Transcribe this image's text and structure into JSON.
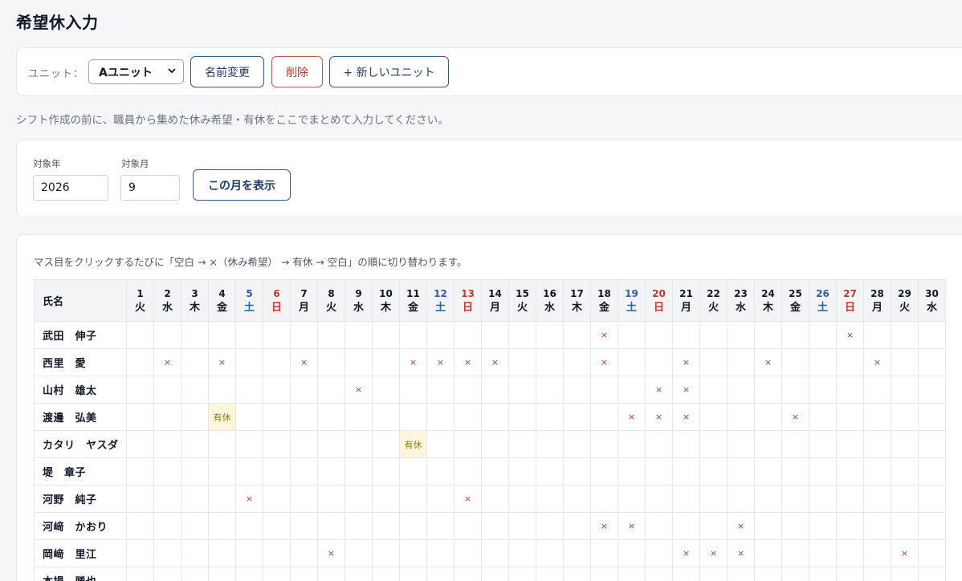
{
  "title": "希望休入力",
  "unit": {
    "label": "ユニット：",
    "selected": "Aユニット",
    "rename_label": "名前変更",
    "delete_label": "削除",
    "new_label": "+ 新しいユニット"
  },
  "note": "シフト作成の前に、職員から集めた休み希望・有休をここでまとめて入力してください。",
  "period": {
    "year_label": "対象年",
    "year_value": "2026",
    "month_label": "対象月",
    "month_value": "9",
    "show_label": "この月を表示"
  },
  "grid": {
    "hint": "マス目をクリックするたびに「空白 → ×（休み希望） → 有休 → 空白」の順に切り替わります。",
    "name_header": "氏名",
    "days": [
      {
        "d": "1",
        "w": "火",
        "t": "weekday"
      },
      {
        "d": "2",
        "w": "水",
        "t": "weekday"
      },
      {
        "d": "3",
        "w": "木",
        "t": "weekday"
      },
      {
        "d": "4",
        "w": "金",
        "t": "weekday"
      },
      {
        "d": "5",
        "w": "土",
        "t": "sat"
      },
      {
        "d": "6",
        "w": "日",
        "t": "sun"
      },
      {
        "d": "7",
        "w": "月",
        "t": "weekday"
      },
      {
        "d": "8",
        "w": "火",
        "t": "weekday"
      },
      {
        "d": "9",
        "w": "水",
        "t": "weekday"
      },
      {
        "d": "10",
        "w": "木",
        "t": "weekday"
      },
      {
        "d": "11",
        "w": "金",
        "t": "weekday"
      },
      {
        "d": "12",
        "w": "土",
        "t": "sat"
      },
      {
        "d": "13",
        "w": "日",
        "t": "sun"
      },
      {
        "d": "14",
        "w": "月",
        "t": "weekday"
      },
      {
        "d": "15",
        "w": "火",
        "t": "weekday"
      },
      {
        "d": "16",
        "w": "水",
        "t": "weekday"
      },
      {
        "d": "17",
        "w": "木",
        "t": "weekday"
      },
      {
        "d": "18",
        "w": "金",
        "t": "weekday"
      },
      {
        "d": "19",
        "w": "土",
        "t": "sat"
      },
      {
        "d": "20",
        "w": "日",
        "t": "sun"
      },
      {
        "d": "21",
        "w": "月",
        "t": "weekday"
      },
      {
        "d": "22",
        "w": "火",
        "t": "weekday"
      },
      {
        "d": "23",
        "w": "水",
        "t": "weekday"
      },
      {
        "d": "24",
        "w": "木",
        "t": "weekday"
      },
      {
        "d": "25",
        "w": "金",
        "t": "weekday"
      },
      {
        "d": "26",
        "w": "土",
        "t": "sat"
      },
      {
        "d": "27",
        "w": "日",
        "t": "sun"
      },
      {
        "d": "28",
        "w": "月",
        "t": "weekday"
      },
      {
        "d": "29",
        "w": "火",
        "t": "weekday"
      },
      {
        "d": "30",
        "w": "水",
        "t": "weekday"
      }
    ],
    "mark_x": "×",
    "mark_paid": "有休",
    "staff": [
      {
        "name": "武田　伸子",
        "x": [
          18,
          27
        ],
        "paid": []
      },
      {
        "name": "西里　愛",
        "x": [
          2,
          4,
          7,
          11,
          12,
          13,
          14,
          18,
          21,
          24,
          28
        ],
        "paid": []
      },
      {
        "name": "山村　雄太",
        "x": [
          9,
          20,
          21
        ],
        "paid": []
      },
      {
        "name": "渡邊　弘美",
        "x": [
          19,
          20,
          21,
          25
        ],
        "paid": [
          4
        ]
      },
      {
        "name": "カタリ　ヤスダ",
        "x": [],
        "paid": [
          11
        ]
      },
      {
        "name": "堤　章子",
        "x": [],
        "paid": []
      },
      {
        "name": "河野　純子",
        "x": [
          5,
          13
        ],
        "paid": []
      },
      {
        "name": "河﨑　かおり",
        "x": [
          18,
          19,
          23
        ],
        "paid": []
      },
      {
        "name": "岡﨑　里江",
        "x": [
          8,
          21,
          22,
          23,
          29
        ],
        "paid": []
      },
      {
        "name": "本場　勝也",
        "x": [],
        "paid": []
      }
    ]
  },
  "colors": {
    "saturday": "#2f5ea8",
    "sunday": "#c0392b",
    "mark_x": "#b23a30",
    "paid_bg": "#fdf5dc"
  }
}
